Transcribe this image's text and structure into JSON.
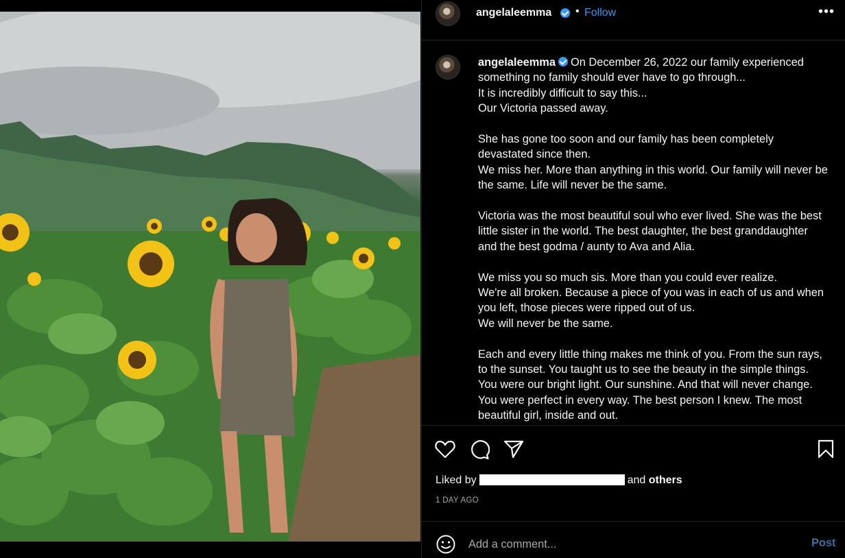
{
  "post": {
    "username": "angelaleemma",
    "follow_label": "Follow",
    "separator": "•",
    "more_label": "•••",
    "photo_alt": "Girl in overalls standing in a sunflower field with mountains behind"
  },
  "caption": {
    "username": "angelaleemma",
    "lines": [
      "On December 26, 2022 our family experienced something no family should ever have to go through...",
      "It is incredibly difficult to say this...",
      "Our Victoria passed away.",
      "",
      "She has gone too soon and our family has been completely devastated since then.",
      "We miss her. More than anything in this world. Our family will never be the same. Life will never be the same.",
      "",
      "Victoria was the most beautiful soul who ever lived. She was the best little sister in the world. The best daughter, the best granddaughter and the best godma / aunty to Ava and Alia.",
      "",
      "We miss you so much sis. More than you could ever realize.",
      "We're all broken. Because a piece of you was in each of us and when you left, those pieces were ripped out of us.",
      "We will never be the same.",
      "",
      "Each and every little thing makes me think of you. From the sun rays, to the sunset. You taught us to see the beauty in the simple things. You were our bright light. Our sunshine. And that will never change. You were perfect in every way. The best person I knew. The most beautiful girl, inside and out."
    ]
  },
  "engagement": {
    "liked_by_prefix": "Liked by",
    "liked_by_suffix": "and",
    "others_label": "others",
    "timestamp": "1 DAY AGO"
  },
  "comment": {
    "placeholder": "Add a comment...",
    "post_label": "Post"
  },
  "icons": {
    "like": "heart-icon",
    "comment": "speech-bubble-icon",
    "share": "paper-plane-icon",
    "save": "bookmark-icon",
    "emoji": "smiley-icon",
    "verified": "verified-badge-icon",
    "more": "ellipsis-icon"
  },
  "colors": {
    "background": "#000000",
    "text": "#f5f5f5",
    "secondary_text": "#a8a8a8",
    "link_blue": "#3897f0",
    "post_button": "#3b6fa0",
    "divider": "#262626"
  }
}
